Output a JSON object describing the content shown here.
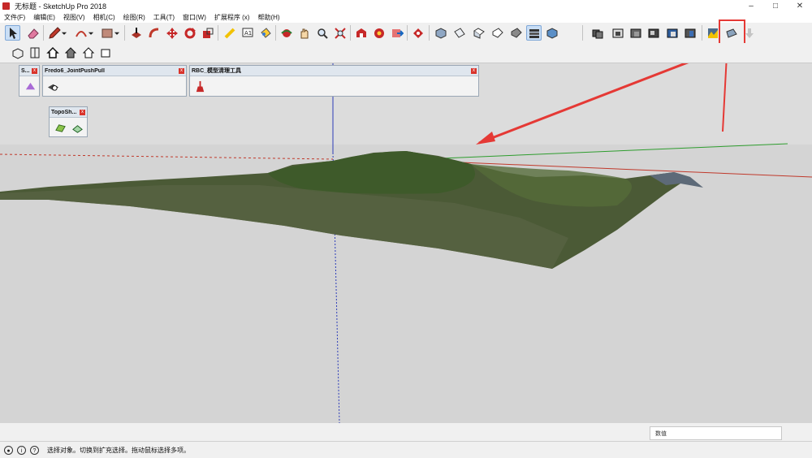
{
  "window": {
    "title": "无标题 - SketchUp Pro 2018",
    "minimize_icon": "minimize-icon",
    "maximize_icon": "maximize-icon",
    "close_icon": "close-icon"
  },
  "menu": [
    "文件(F)",
    "编辑(E)",
    "视图(V)",
    "相机(C)",
    "绘图(R)",
    "工具(T)",
    "窗口(W)",
    "扩展程序 (x)",
    "帮助(H)"
  ],
  "panels": {
    "small": {
      "title": "S..."
    },
    "joint_push_pull": {
      "title": "Fredo6_JointPushPull"
    },
    "rbc": {
      "title": "RBC_模型清理工具"
    },
    "topo": {
      "title": "TopoSh..."
    }
  },
  "status": {
    "text": "选择对象。切换到扩充选择。拖动鼠标选择多项。",
    "measure_label": "数值"
  },
  "colors": {
    "terrain": "#4b5a36",
    "highlight": "#e53935",
    "axis_red": "#c0392b",
    "axis_green": "#2e9d2e",
    "axis_blue": "#2b3bb8",
    "sky": "#dcdcdc",
    "ground": "#d4d4d4"
  }
}
